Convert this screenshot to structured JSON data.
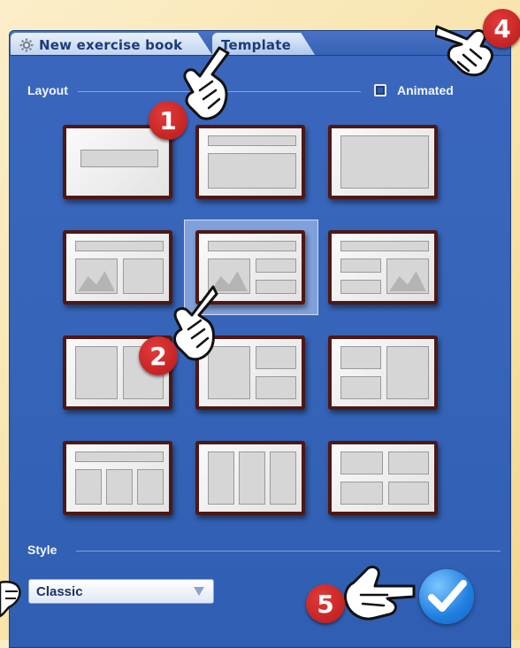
{
  "tabs": [
    {
      "label": "New exercise book",
      "icon": "gear-icon"
    },
    {
      "label": "Template"
    }
  ],
  "layout_section": {
    "label": "Layout"
  },
  "animated": {
    "label": "Animated",
    "checked": false
  },
  "style_section": {
    "label": "Style"
  },
  "style_select": {
    "value": "Classic"
  },
  "callouts": {
    "c1": "1",
    "c2": "2",
    "c4": "4",
    "c5": "5"
  },
  "colors": {
    "panel": "#3564b8",
    "thumb_border": "#4d1815",
    "badge": "#c82222",
    "confirm": "#1f7fe0"
  }
}
